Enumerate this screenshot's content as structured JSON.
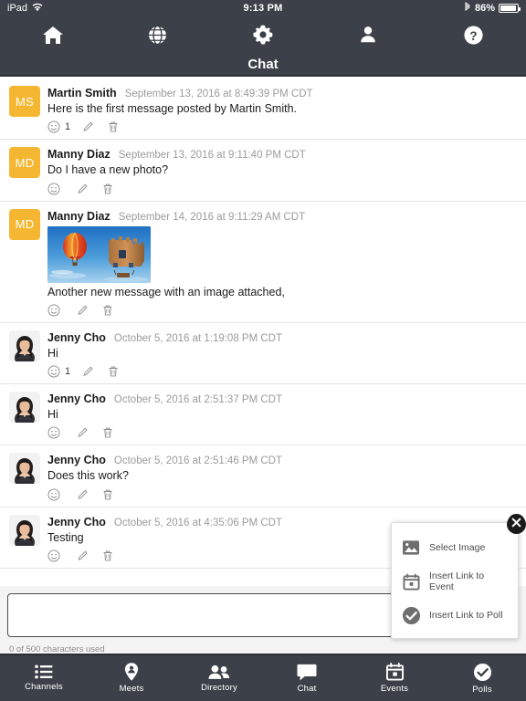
{
  "status_bar": {
    "device": "iPad",
    "wifi_icon": "wifi-icon",
    "time": "9:13 PM",
    "bluetooth_icon": "bluetooth-icon",
    "battery_percent": "86%"
  },
  "top_nav": {
    "items": [
      {
        "name": "home",
        "icon": "home-icon"
      },
      {
        "name": "globe",
        "icon": "globe-icon"
      },
      {
        "name": "settings",
        "icon": "gear-icon"
      },
      {
        "name": "profile",
        "icon": "person-icon"
      },
      {
        "name": "help",
        "icon": "question-mark-icon"
      }
    ]
  },
  "title_bar": {
    "title": "Chat"
  },
  "messages": [
    {
      "author": "Martin Smith",
      "timestamp": "September 13, 2016 at 8:49:39 PM CDT",
      "text": "Here is the first message posted by Martin Smith.",
      "avatar_initials": "MS",
      "avatar_color": "#F5B731",
      "avatar_type": "initials",
      "reaction_count": "1",
      "attachment": null
    },
    {
      "author": "Manny Diaz",
      "timestamp": "September 13, 2016 at 9:11:40 PM CDT",
      "text": "Do I have a new photo?",
      "avatar_initials": "MD",
      "avatar_color": "#F5B731",
      "avatar_type": "initials",
      "reaction_count": "",
      "attachment": null
    },
    {
      "author": "Manny Diaz",
      "timestamp": "September 14, 2016 at 9:11:29 AM CDT",
      "text": "Another new message with an image attached,",
      "avatar_initials": "MD",
      "avatar_color": "#F5B731",
      "avatar_type": "initials",
      "reaction_count": "",
      "attachment": "hot-air-balloons-photo"
    },
    {
      "author": "Jenny Cho",
      "timestamp": "October 5, 2016 at 1:19:08 PM CDT",
      "text": "Hi",
      "avatar_initials": "",
      "avatar_color": "#f4f4f4",
      "avatar_type": "photo",
      "reaction_count": "1",
      "attachment": null
    },
    {
      "author": "Jenny Cho",
      "timestamp": "October 5, 2016 at 2:51:37 PM CDT",
      "text": "Hi",
      "avatar_initials": "",
      "avatar_color": "#f4f4f4",
      "avatar_type": "photo",
      "reaction_count": "",
      "attachment": null
    },
    {
      "author": "Jenny Cho",
      "timestamp": "October 5, 2016 at 2:51:46 PM CDT",
      "text": "Does this work?",
      "avatar_initials": "",
      "avatar_color": "#f4f4f4",
      "avatar_type": "photo",
      "reaction_count": "",
      "attachment": null
    },
    {
      "author": "Jenny Cho",
      "timestamp": "October 5, 2016 at 4:35:06 PM CDT",
      "text": "Testing",
      "avatar_initials": "",
      "avatar_color": "#f4f4f4",
      "avatar_type": "photo",
      "reaction_count": "",
      "attachment": null
    }
  ],
  "message_actions": {
    "react_icon": "smiley-face-icon",
    "edit_icon": "pencil-icon",
    "delete_icon": "trash-icon"
  },
  "composer": {
    "value": "",
    "placeholder": "",
    "char_count": "0 of 500 characters used"
  },
  "popup": {
    "close_icon": "close-circle-icon",
    "items": [
      {
        "label": "Select Image",
        "icon": "image-icon"
      },
      {
        "label": "Insert Link to Event",
        "icon": "calendar-icon"
      },
      {
        "label": "Insert Link to Poll",
        "icon": "check-circle-icon"
      }
    ]
  },
  "tab_bar": {
    "active": "Chat",
    "items": [
      {
        "label": "Channels",
        "icon": "list-icon"
      },
      {
        "label": "Meets",
        "icon": "map-pin-person-icon"
      },
      {
        "label": "Directory",
        "icon": "people-icon"
      },
      {
        "label": "Chat",
        "icon": "chat-bubble-icon"
      },
      {
        "label": "Events",
        "icon": "calendar-icon"
      },
      {
        "label": "Polls",
        "icon": "check-circle-icon"
      }
    ]
  },
  "colors": {
    "chrome": "#3c4149",
    "avatar_amber": "#F5B731",
    "text_primary": "#1b1b1b",
    "text_muted": "#9b9b9b"
  }
}
